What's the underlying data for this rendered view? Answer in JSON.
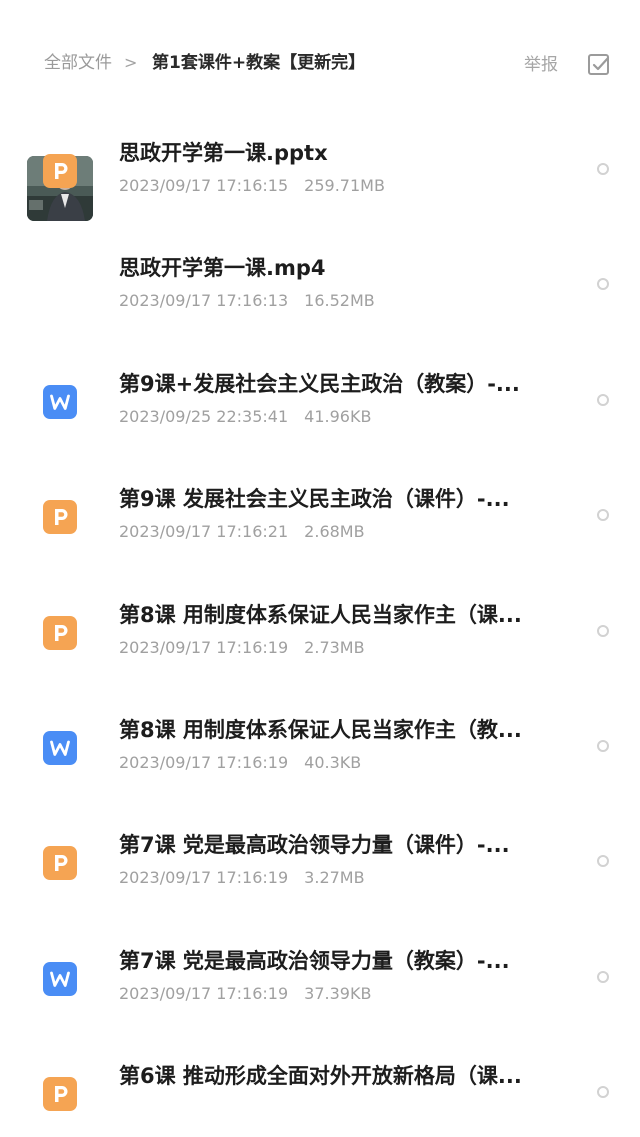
{
  "breadcrumb": {
    "root": "全部文件",
    "separator": ">",
    "current": "第1套课件+教案【更新完】"
  },
  "actions": {
    "report": "举报",
    "select_icon": "checkbox-icon"
  },
  "colors": {
    "ppt_orange": "#F5A453",
    "word_blue": "#4A8DF5",
    "meta_gray": "#A0A0A0"
  },
  "files": [
    {
      "name": "思政开学第一课.pptx",
      "date": "2023/09/17 17:16:15",
      "size": "259.71MB",
      "type": "ppt"
    },
    {
      "name": "思政开学第一课.mp4",
      "date": "2023/09/17 17:16:13",
      "size": "16.52MB",
      "type": "video"
    },
    {
      "name": "第9课+发展社会主义民主政治（教案）-...",
      "date": "2023/09/25 22:35:41",
      "size": "41.96KB",
      "type": "word"
    },
    {
      "name": "第9课 发展社会主义民主政治（课件）-...",
      "date": "2023/09/17 17:16:21",
      "size": "2.68MB",
      "type": "ppt"
    },
    {
      "name": "第8课 用制度体系保证人民当家作主（课...",
      "date": "2023/09/17 17:16:19",
      "size": "2.73MB",
      "type": "ppt"
    },
    {
      "name": "第8课 用制度体系保证人民当家作主（教...",
      "date": "2023/09/17 17:16:19",
      "size": "40.3KB",
      "type": "word"
    },
    {
      "name": "第7课 党是最高政治领导力量（课件）-...",
      "date": "2023/09/17 17:16:19",
      "size": "3.27MB",
      "type": "ppt"
    },
    {
      "name": "第7课 党是最高政治领导力量（教案）-...",
      "date": "2023/09/17 17:16:19",
      "size": "37.39KB",
      "type": "word"
    },
    {
      "name": "第6课 推动形成全面对外开放新格局（课...",
      "date": "",
      "size": "",
      "type": "ppt"
    }
  ]
}
